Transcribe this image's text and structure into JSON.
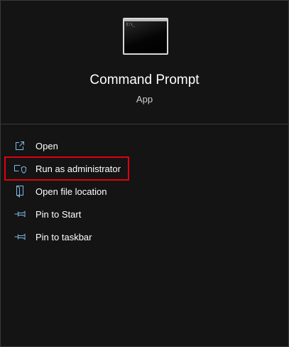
{
  "app": {
    "title": "Command Prompt",
    "type": "App",
    "icon": "terminal-icon"
  },
  "menu": {
    "items": [
      {
        "label": "Open",
        "icon": "open-icon"
      },
      {
        "label": "Run as administrator",
        "icon": "shield-icon"
      },
      {
        "label": "Open file location",
        "icon": "folder-icon"
      },
      {
        "label": "Pin to Start",
        "icon": "pin-icon"
      },
      {
        "label": "Pin to taskbar",
        "icon": "pin-icon"
      }
    ],
    "highlighted_item": "Run as administrator"
  },
  "colors": {
    "background": "#141414",
    "icon_stroke": "#7db9e8",
    "highlight_border": "#e0000d"
  }
}
